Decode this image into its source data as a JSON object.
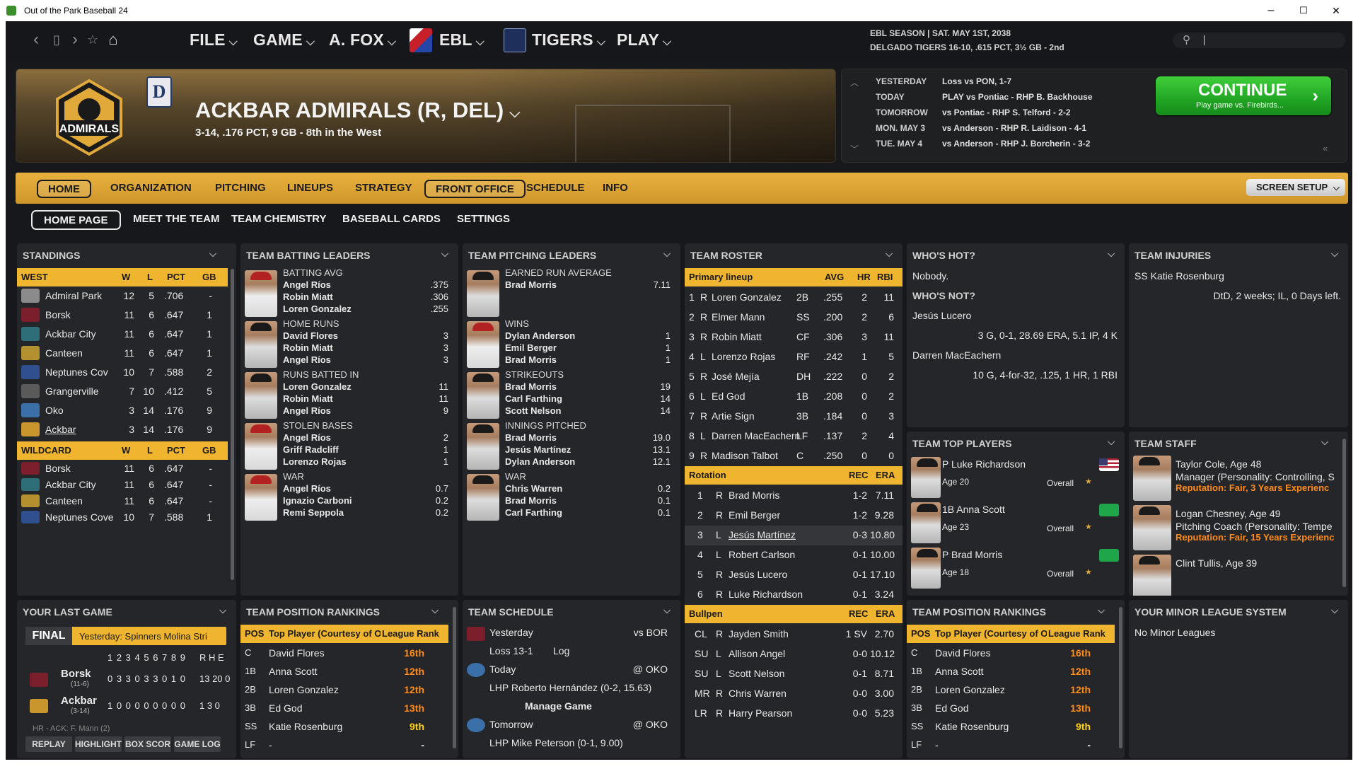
{
  "window": {
    "title": "Out of the Park Baseball 24",
    "minimize": "–",
    "maximize": "☐",
    "close": "✕"
  },
  "nav": {
    "back": "‹",
    "page": "▯",
    "forward": "›",
    "star": "☆",
    "home": "⌂"
  },
  "menu": {
    "file": "FILE",
    "game": "GAME",
    "manager": "A. FOX",
    "league": "EBL",
    "team": "TIGERS",
    "play": "PLAY"
  },
  "season": {
    "line1": "EBL SEASON | SAT. MAY 1ST, 2038",
    "line2": "DELGADO TIGERS 16-10, .615 PCT, 3½ GB - 2nd"
  },
  "search": {
    "placeholder": ""
  },
  "header": {
    "team_name": "ACKBAR ADMIRALS (R, DEL)",
    "record": "3-14, .176 PCT, 9 GB - 8th in the West",
    "mini_logo": "D"
  },
  "schedule_strip": [
    {
      "day": "YESTERDAY",
      "text": "Loss vs PON, 1-7"
    },
    {
      "day": "TODAY",
      "text": "PLAY vs Pontiac - RHP B. Backhouse"
    },
    {
      "day": "TOMORROW",
      "text": "vs Pontiac - RHP S. Telford - 2-2"
    },
    {
      "day": "MON. MAY 3",
      "text": "vs Anderson - RHP R. Laidison - 4-1"
    },
    {
      "day": "TUE. MAY 4",
      "text": "vs Anderson - RHP J. Borcherin - 3-2"
    }
  ],
  "continue": {
    "label": "CONTINUE",
    "sub": "Play game vs. Firebirds..."
  },
  "tabs": [
    "HOME",
    "ORGANIZATION",
    "PITCHING",
    "LINEUPS",
    "STRATEGY",
    "FRONT OFFICE",
    "SCHEDULE",
    "INFO"
  ],
  "screen_setup": "SCREEN SETUP",
  "subtabs": [
    "HOME PAGE",
    "MEET THE TEAM",
    "TEAM CHEMISTRY",
    "BASEBALL CARDS",
    "SETTINGS"
  ],
  "standings": {
    "title": "STANDINGS",
    "division": "WEST",
    "wildcard": "WILDCARD",
    "cols": [
      "W",
      "L",
      "PCT",
      "GB"
    ],
    "rows": [
      [
        "Admiral Park",
        "12",
        "5",
        ".706",
        "-"
      ],
      [
        "Borsk",
        "11",
        "6",
        ".647",
        "1"
      ],
      [
        "Ackbar City",
        "11",
        "6",
        ".647",
        "1"
      ],
      [
        "Canteen",
        "11",
        "6",
        ".647",
        "1"
      ],
      [
        "Neptunes Cov",
        "10",
        "7",
        ".588",
        "2"
      ],
      [
        "Grangerville",
        "7",
        "10",
        ".412",
        "5"
      ],
      [
        "Oko",
        "3",
        "14",
        ".176",
        "9"
      ],
      [
        "Ackbar",
        "3",
        "14",
        ".176",
        "9"
      ]
    ],
    "wc_rows": [
      [
        "Borsk",
        "11",
        "6",
        ".647",
        "-"
      ],
      [
        "Ackbar City",
        "11",
        "6",
        ".647",
        "-"
      ],
      [
        "Canteen",
        "11",
        "6",
        ".647",
        "-"
      ],
      [
        "Neptunes Cove",
        "10",
        "7",
        ".588",
        "1"
      ]
    ]
  },
  "batting": {
    "title": "TEAM BATTING LEADERS",
    "groups": [
      {
        "cat": "BATTING AVG",
        "p": [
          [
            "Angel Ríos",
            ".375"
          ],
          [
            "Robin Miatt",
            ".306"
          ],
          [
            "Loren Gonzalez",
            ".255"
          ]
        ]
      },
      {
        "cat": "HOME RUNS",
        "p": [
          [
            "David Flores",
            "3"
          ],
          [
            "Robin Miatt",
            "3"
          ],
          [
            "Angel Ríos",
            "3"
          ]
        ]
      },
      {
        "cat": "RUNS BATTED IN",
        "p": [
          [
            "Loren Gonzalez",
            "11"
          ],
          [
            "Robin Miatt",
            "11"
          ],
          [
            "Angel Ríos",
            "9"
          ]
        ]
      },
      {
        "cat": "STOLEN BASES",
        "p": [
          [
            "Angel Ríos",
            "2"
          ],
          [
            "Griff Radcliff",
            "1"
          ],
          [
            "Lorenzo Rojas",
            "1"
          ]
        ]
      },
      {
        "cat": "WAR",
        "p": [
          [
            "Angel Ríos",
            "0.7"
          ],
          [
            "Ignazio Carboni",
            "0.2"
          ],
          [
            "Remi Seppola",
            "0.2"
          ]
        ]
      }
    ]
  },
  "pitching": {
    "title": "TEAM PITCHING LEADERS",
    "groups": [
      {
        "cat": "EARNED RUN AVERAGE",
        "p": [
          [
            "Brad Morris",
            "7.11"
          ]
        ]
      },
      {
        "cat": "WINS",
        "p": [
          [
            "Dylan Anderson",
            "1"
          ],
          [
            "Emil Berger",
            "1"
          ],
          [
            "Brad Morris",
            "1"
          ]
        ]
      },
      {
        "cat": "STRIKEOUTS",
        "p": [
          [
            "Brad Morris",
            "19"
          ],
          [
            "Carl Farthing",
            "14"
          ],
          [
            "Scott Nelson",
            "14"
          ]
        ]
      },
      {
        "cat": "INNINGS PITCHED",
        "p": [
          [
            "Brad Morris",
            "19.0"
          ],
          [
            "Jesús Martínez",
            "13.1"
          ],
          [
            "Dylan Anderson",
            "12.1"
          ]
        ]
      },
      {
        "cat": "WAR",
        "p": [
          [
            "Chris Warren",
            "0.2"
          ],
          [
            "Brad Morris",
            "0.1"
          ],
          [
            "Carl Farthing",
            "0.1"
          ]
        ]
      }
    ]
  },
  "roster": {
    "title": "TEAM ROSTER",
    "lineup_hdr": "Primary lineup",
    "lineup_cols": [
      "AVG",
      "HR",
      "RBI"
    ],
    "lineup": [
      [
        "1",
        "R",
        "Loren Gonzalez",
        "2B",
        ".255",
        "2",
        "11"
      ],
      [
        "2",
        "R",
        "Elmer Mann",
        "SS",
        ".200",
        "2",
        "6"
      ],
      [
        "3",
        "R",
        "Robin Miatt",
        "CF",
        ".306",
        "3",
        "11"
      ],
      [
        "4",
        "L",
        "Lorenzo Rojas",
        "RF",
        ".242",
        "1",
        "5"
      ],
      [
        "5",
        "R",
        "José Mejía",
        "DH",
        ".222",
        "0",
        "2"
      ],
      [
        "6",
        "L",
        "Ed God",
        "1B",
        ".208",
        "0",
        "2"
      ],
      [
        "7",
        "R",
        "Artie Sign",
        "3B",
        ".184",
        "0",
        "3"
      ],
      [
        "8",
        "L",
        "Darren MacEachern",
        "LF",
        ".137",
        "2",
        "4"
      ],
      [
        "9",
        "R",
        "Madison Talbot",
        "C",
        ".250",
        "0",
        "0"
      ]
    ],
    "rot_hdr": "Rotation",
    "rot_cols": [
      "REC",
      "ERA"
    ],
    "rotation": [
      [
        "1",
        "R",
        "Brad Morris",
        "1-2",
        "7.11"
      ],
      [
        "2",
        "R",
        "Emil Berger",
        "1-2",
        "9.28"
      ],
      [
        "3",
        "L",
        "Jesús Martínez",
        "0-3",
        "10.80"
      ],
      [
        "4",
        "L",
        "Robert Carlson",
        "0-1",
        "10.00"
      ],
      [
        "5",
        "R",
        "Jesús Lucero",
        "0-1",
        "17.10"
      ],
      [
        "6",
        "R",
        "Luke Richardson",
        "0-1",
        "3.24"
      ]
    ],
    "bp_hdr": "Bullpen",
    "bullpen": [
      [
        "CL",
        "R",
        "Jayden Smith",
        "1 SV",
        "2.70"
      ],
      [
        "SU",
        "L",
        "Allison Angel",
        "0-0",
        "10.12"
      ],
      [
        "SU",
        "L",
        "Scott Nelson",
        "0-1",
        "8.71"
      ],
      [
        "MR",
        "R",
        "Chris Warren",
        "0-0",
        "3.00"
      ],
      [
        "LR",
        "R",
        "Harry Pearson",
        "0-0",
        "5.23"
      ]
    ]
  },
  "whos_hot": {
    "title": "WHO'S HOT?",
    "text": "Nobody.",
    "not_title": "WHO'S NOT?",
    "not": [
      {
        "name": "Jesús Lucero",
        "line": "3 G, 0-1, 28.69 ERA, 5.1 IP, 4 K"
      },
      {
        "name": "Darren MacEachern",
        "line": "10 G, 4-for-32, .125, 1 HR, 1 RBI"
      }
    ]
  },
  "injuries": {
    "title": "TEAM INJURIES",
    "name": "SS Katie Rosenburg",
    "detail": "DtD, 2 weeks; IL, 0 Days left."
  },
  "top_players": {
    "title": "TEAM TOP PLAYERS",
    "overall": "Overall",
    "players": [
      {
        "name": "P Luke Richardson",
        "age": "Age 20"
      },
      {
        "name": "1B Anna Scott",
        "age": "Age 23"
      },
      {
        "name": "P Brad Morris",
        "age": "Age 18"
      }
    ]
  },
  "staff": {
    "title": "TEAM STAFF",
    "members": [
      {
        "name": "Taylor Cole, Age 48",
        "role": "Manager (Personality: Controlling, S",
        "rep": "Reputation: Fair, 3 Years Experienc"
      },
      {
        "name": "Logan Chesney, Age 49",
        "role": "Pitching Coach (Personality: Tempe",
        "rep": "Reputation: Fair, 15 Years Experienc"
      },
      {
        "name": "Clint Tullis, Age 39",
        "role": "",
        "rep": ""
      }
    ]
  },
  "last_game": {
    "title": "YOUR LAST GAME",
    "final": "FINAL",
    "yesterday": "Yesterday: Spinners Molina Stri",
    "innings": "1 2 3 4 5 6 7 8 9",
    "rhe": "R H E",
    "teams": [
      {
        "name": "Borsk",
        "rec": "(11-6)",
        "line": "0 3 3 0 3 3 0 1 0",
        "rhe": "13 20 0"
      },
      {
        "name": "Ackbar",
        "rec": "(3-14)",
        "line": "1 0 0 0 0 0 0 0 0",
        "rhe": "1 3 0"
      }
    ],
    "note": "HR - ACK: F. Mann (2)",
    "buttons": [
      "REPLAY",
      "HIGHLIGHT",
      "BOX SCOR",
      "GAME LOG"
    ]
  },
  "pos_rank": {
    "title": "TEAM POSITION RANKINGS",
    "cols": [
      "POS",
      "Top Player (Courtesy of OS",
      "League Rank"
    ],
    "rows": [
      [
        "C",
        "David Flores",
        "16th"
      ],
      [
        "1B",
        "Anna Scott",
        "12th"
      ],
      [
        "2B",
        "Loren Gonzalez",
        "12th"
      ],
      [
        "3B",
        "Ed God",
        "13th"
      ],
      [
        "SS",
        "Katie Rosenburg",
        "9th"
      ],
      [
        "LF",
        "-",
        "-"
      ]
    ]
  },
  "team_schedule": {
    "title": "TEAM SCHEDULE",
    "items": [
      {
        "when": "Yesterday",
        "opp": "vs BOR",
        "l1": "Loss 13-1",
        "l2": "Log"
      },
      {
        "when": "Today",
        "opp": "@ OKO",
        "l1": "LHP Roberto Hernández (0-2, 15.63)",
        "l2": "Manage Game"
      },
      {
        "when": "Tomorrow",
        "opp": "@ OKO",
        "l1": "LHP Mike Peterson (0-1, 9.00)",
        "l2": ""
      }
    ]
  },
  "minor": {
    "title": "YOUR MINOR LEAGUE SYSTEM",
    "text": "No Minor Leagues"
  },
  "colors": {
    "accent": "#f0b52e",
    "green": "#21a524",
    "panel": "#242629",
    "rank_orange": "#ff8c1a",
    "rank_yellow": "#ffd21a"
  }
}
